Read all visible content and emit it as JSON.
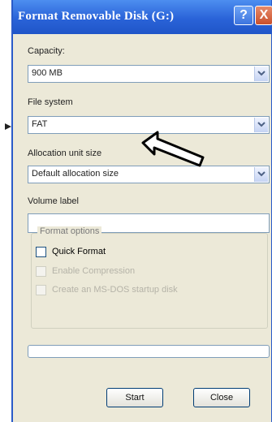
{
  "window": {
    "title": "Format Removable Disk (G:)"
  },
  "titlebar_buttons": {
    "help": "?",
    "close": "X"
  },
  "capacity": {
    "label": "Capacity:",
    "value": "900 MB"
  },
  "file_system": {
    "label": "File system",
    "value": "FAT"
  },
  "allocation": {
    "label": "Allocation unit size",
    "value": "Default allocation size"
  },
  "volume_label": {
    "label": "Volume label",
    "value": ""
  },
  "format_options": {
    "title": "Format options",
    "quick_format": "Quick Format",
    "enable_compression": "Enable Compression",
    "create_msdos": "Create an MS-DOS startup disk"
  },
  "progress": {
    "value": 0
  },
  "buttons": {
    "start": "Start",
    "close": "Close"
  },
  "colors": {
    "titlebar": "#2a63d8",
    "window_bg": "#ece9d8",
    "field_border": "#7f9db9"
  }
}
